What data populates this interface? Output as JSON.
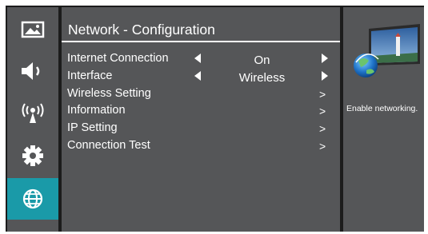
{
  "sidebar": {
    "items": [
      {
        "name": "picture-icon",
        "active": false
      },
      {
        "name": "sound-icon",
        "active": false
      },
      {
        "name": "wireless-icon",
        "active": false
      },
      {
        "name": "settings-gear-icon",
        "active": false
      },
      {
        "name": "network-globe-icon",
        "active": true
      }
    ],
    "active_color": "#1a9aa8"
  },
  "main": {
    "title": "Network - Configuration",
    "rows": [
      {
        "label": "Internet Connection",
        "type": "selector",
        "value": "On"
      },
      {
        "label": "Interface",
        "type": "selector",
        "value": "Wireless"
      },
      {
        "label": "Wireless Setting",
        "type": "submenu",
        "chevron": ">"
      },
      {
        "label": "Information",
        "type": "submenu",
        "chevron": ">"
      },
      {
        "label": "IP Setting",
        "type": "submenu",
        "chevron": ">"
      },
      {
        "label": "Connection Test",
        "type": "submenu",
        "chevron": ">"
      }
    ]
  },
  "help": {
    "image": "network-globe-tv-icon",
    "text": "Enable networking."
  }
}
